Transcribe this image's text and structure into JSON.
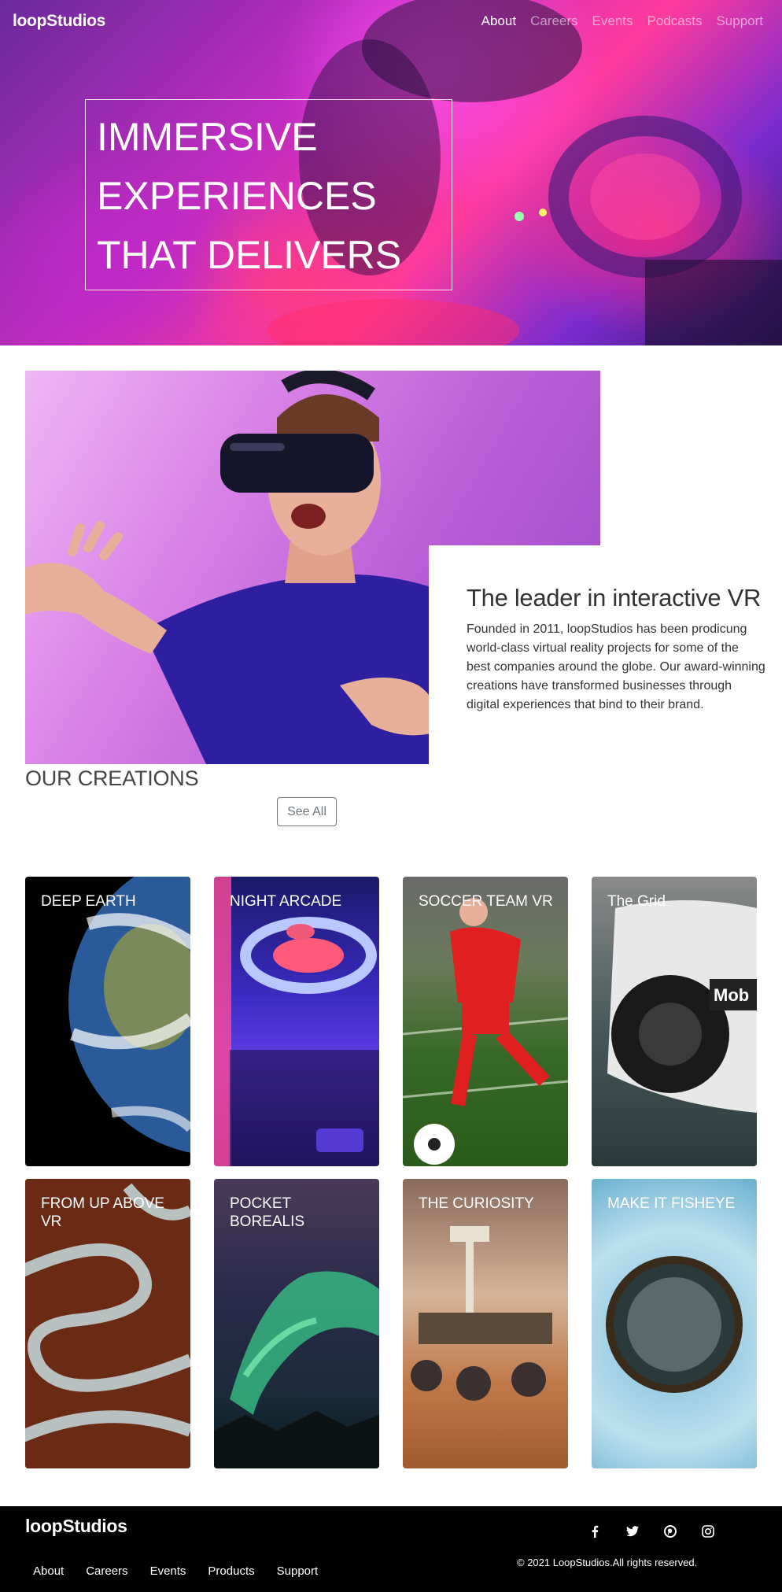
{
  "brand": {
    "logo": "loopStudios"
  },
  "nav": {
    "items": [
      "About",
      "Careers",
      "Events",
      "Podcasts",
      "Support"
    ]
  },
  "hero": {
    "title": "IMMERSIVE EXPERIENCES THAT DELIVERS"
  },
  "about": {
    "title": "The leader in interactive VR",
    "body": "Founded in 2011, loopStudios has been prodicung world-class virtual reality projects for some of the best companies around the globe. Our award-winning creations have transformed businesses through digital experiences that bind to their brand."
  },
  "creations": {
    "title": "OUR CREATIONS",
    "see_all": "See All",
    "cards": [
      {
        "title": "DEEP EARTH"
      },
      {
        "title": "NIGHT ARCADE"
      },
      {
        "title": "SOCCER TEAM VR"
      },
      {
        "title": "The Grid"
      },
      {
        "title": "FROM UP ABOVE VR"
      },
      {
        "title": "POCKET BOREALIS"
      },
      {
        "title": "THE CURIOSITY"
      },
      {
        "title": "MAKE IT FISHEYE"
      }
    ]
  },
  "footer": {
    "logo": "loopStudios",
    "links": [
      "About",
      "Careers",
      "Events",
      "Products",
      "Support"
    ],
    "copyright": "© 2021 LoopStudios.All rights reserved.",
    "social": [
      "facebook-icon",
      "twitter-icon",
      "pinterest-icon",
      "instagram-icon"
    ]
  },
  "colors": {
    "footer_bg": "#000000",
    "text_dark": "#333333",
    "button_border": "#6c757d"
  }
}
